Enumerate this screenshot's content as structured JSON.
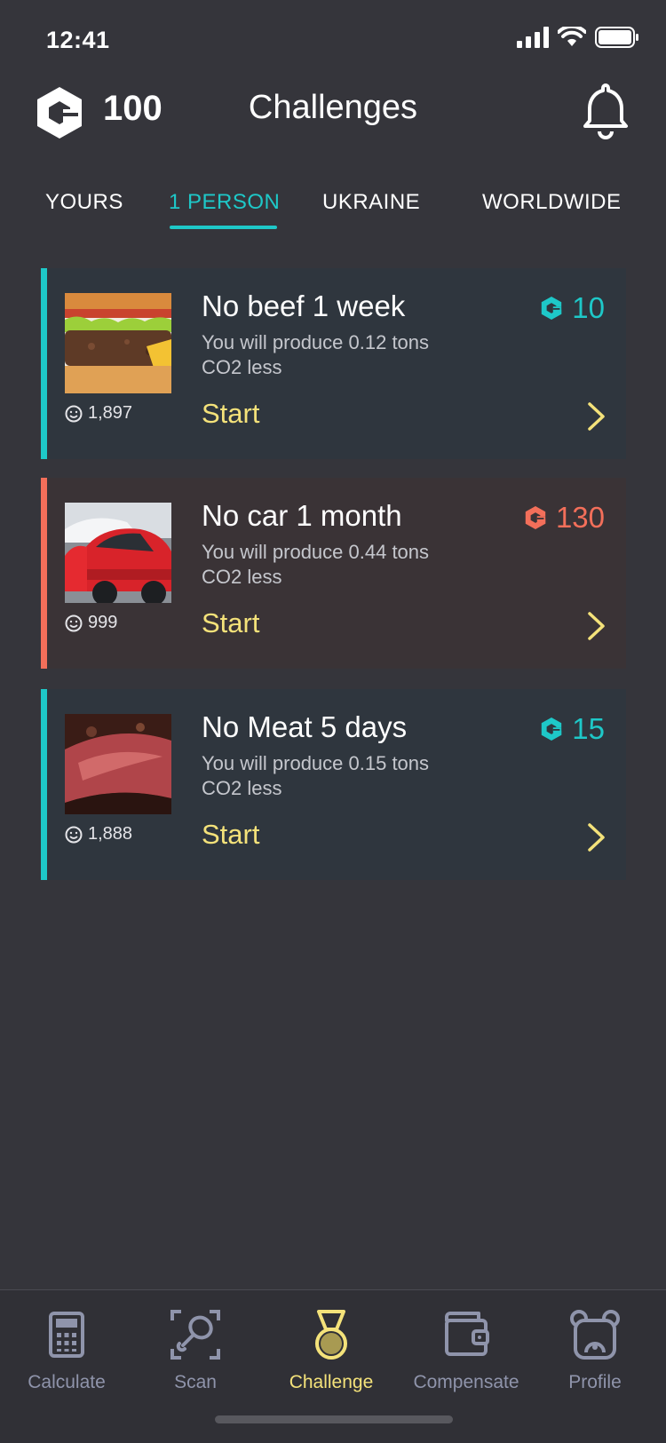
{
  "status": {
    "time": "12:41"
  },
  "header": {
    "points": "100",
    "title": "Challenges"
  },
  "tabs": [
    {
      "label": "YOURS",
      "active": false
    },
    {
      "label": "1 PERSON",
      "active": true
    },
    {
      "label": "UKRAINE",
      "active": false
    },
    {
      "label": "WORLDWIDE",
      "active": false
    }
  ],
  "cards": [
    {
      "title": "No beef 1 week",
      "desc_line1": "You will produce 0.12 tons",
      "desc_line2": "CO2 less",
      "start": "Start",
      "reward": "10",
      "count": "1,897",
      "accent": "#1ec8c8",
      "image": "burger-image"
    },
    {
      "title": "No car 1 month",
      "desc_line1": "You will produce 0.44 tons",
      "desc_line2": "CO2 less",
      "start": "Start",
      "reward": "130",
      "count": "999",
      "accent": "#f36f5a",
      "image": "cars-image"
    },
    {
      "title": "No Meat 5 days",
      "desc_line1": "You will produce 0.15 tons",
      "desc_line2": "CO2 less",
      "start": "Start",
      "reward": "15",
      "count": "1,888",
      "accent": "#1ec8c8",
      "image": "steak-image"
    }
  ],
  "nav": [
    {
      "label": "Calculate",
      "icon": "calculator-icon",
      "active": false
    },
    {
      "label": "Scan",
      "icon": "scan-icon",
      "active": false
    },
    {
      "label": "Challenge",
      "icon": "medal-icon",
      "active": true
    },
    {
      "label": "Compensate",
      "icon": "wallet-icon",
      "active": false
    },
    {
      "label": "Profile",
      "icon": "bear-icon",
      "active": false
    }
  ],
  "colors": {
    "background": "#35353b",
    "teal": "#1ec8c8",
    "coral": "#f36f5a",
    "yellow": "#f4e27a",
    "card_teal_bg": "#2f363e",
    "card_coral_bg": "#3a3336",
    "nav_grey": "#8f94ab"
  }
}
